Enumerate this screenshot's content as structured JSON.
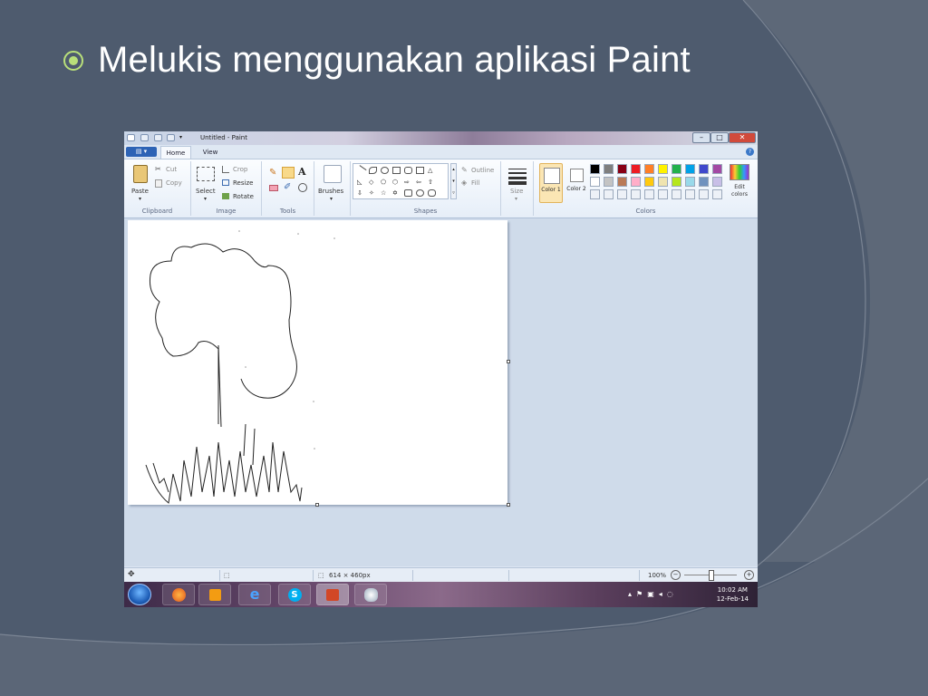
{
  "slide": {
    "title": "Melukis menggunakan aplikasi Paint"
  },
  "window": {
    "title": "Untitled - Paint",
    "minimize": "–",
    "maximize": "□",
    "close": "✕"
  },
  "ribbon_tabs": {
    "file": "▤ ▾",
    "home": "Home",
    "view": "View",
    "help": "?"
  },
  "clipboard": {
    "paste": "Paste",
    "cut": "Cut",
    "copy": "Copy",
    "label": "Clipboard"
  },
  "image": {
    "select": "Select",
    "crop": "Crop",
    "resize": "Resize",
    "rotate": "Rotate",
    "label": "Image"
  },
  "tools": {
    "label": "Tools",
    "text": "A"
  },
  "brushes": {
    "label": "Brushes"
  },
  "shapes": {
    "outline": "Outline",
    "fill": "Fill",
    "label": "Shapes"
  },
  "size": {
    "label": "Size"
  },
  "colors": {
    "color1": "Color 1",
    "color2": "Color 2",
    "edit": "Edit colors",
    "label": "Colors",
    "palette_row1": [
      "#000000",
      "#7f7f7f",
      "#880015",
      "#ed1c24",
      "#ff7f27",
      "#fff200",
      "#22b14c",
      "#00a2e8",
      "#3f48cc",
      "#a349a4"
    ],
    "palette_row2": [
      "#ffffff",
      "#c3c3c3",
      "#b97a57",
      "#ffaec9",
      "#ffc90e",
      "#efe4b0",
      "#b5e61d",
      "#99d9ea",
      "#7092be",
      "#c8bfe7"
    ]
  },
  "status": {
    "dimensions": "614 × 460px",
    "zoom": "100%"
  },
  "taskbar": {
    "time": "10:02 AM",
    "date": "12-Feb-14"
  },
  "theme": {
    "background": "#4e5b6e",
    "accent": "#b9e07a"
  }
}
